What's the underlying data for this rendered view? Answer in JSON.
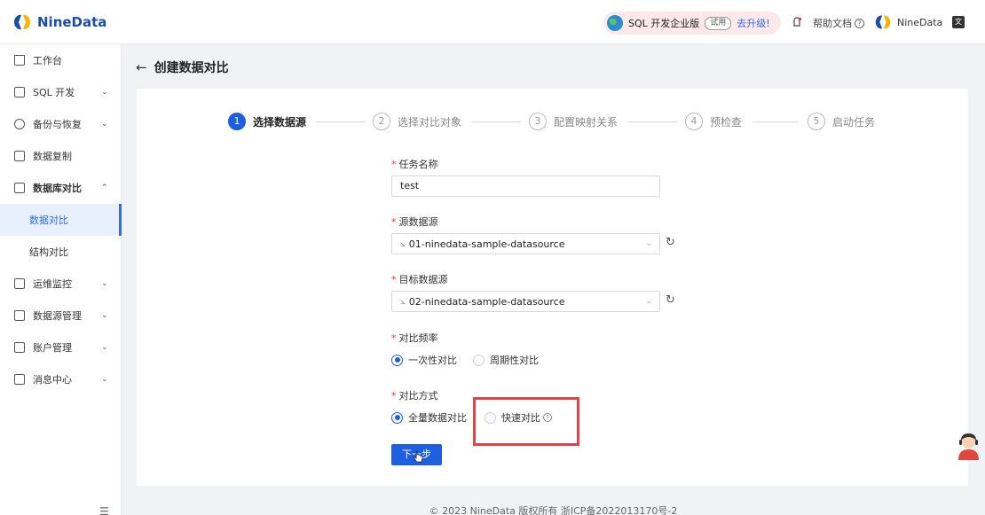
{
  "app": {
    "name": "NineData"
  },
  "topbar": {
    "promo_label": "SQL 开发企业版",
    "trial_tag": "试用",
    "upgrade_link": "去升级!",
    "help_label": "帮助文档",
    "user_name": "NineData",
    "brand_color": "#1b4ea8",
    "accent_color": "#1e5ee0"
  },
  "sidebar": {
    "items": [
      {
        "label": "工作台",
        "icon": "home-icon"
      },
      {
        "label": "SQL 开发",
        "icon": "monitor-icon"
      },
      {
        "label": "备份与恢复",
        "icon": "backup-icon"
      },
      {
        "label": "数据复制",
        "icon": "copy-icon"
      },
      {
        "label": "数据库对比",
        "icon": "compare-icon"
      },
      {
        "label": "数据对比"
      },
      {
        "label": "结构对比"
      },
      {
        "label": "运维监控",
        "icon": "alarm-icon"
      },
      {
        "label": "数据源管理",
        "icon": "datasource-icon"
      },
      {
        "label": "账户管理",
        "icon": "account-icon"
      },
      {
        "label": "消息中心",
        "icon": "message-icon"
      }
    ]
  },
  "page": {
    "title": "创建数据对比"
  },
  "steps": [
    {
      "num": "1",
      "label": "选择数据源"
    },
    {
      "num": "2",
      "label": "选择对比对象"
    },
    {
      "num": "3",
      "label": "配置映射关系"
    },
    {
      "num": "4",
      "label": "预检查"
    },
    {
      "num": "5",
      "label": "启动任务"
    }
  ],
  "form": {
    "task_name_label": "任务名称",
    "task_name_value": "test",
    "source_label": "源数据源",
    "source_value": "01-ninedata-sample-datasource",
    "target_label": "目标数据源",
    "target_value": "02-ninedata-sample-datasource",
    "frequency_label": "对比频率",
    "freq_once": "一次性对比",
    "freq_periodic": "周期性对比",
    "mode_label": "对比方式",
    "mode_full": "全量数据对比",
    "mode_fast": "快速对比",
    "next_button": "下一步"
  },
  "footer": {
    "text": "© 2023 NineData 版权所有 浙ICP备2022013170号-2"
  }
}
